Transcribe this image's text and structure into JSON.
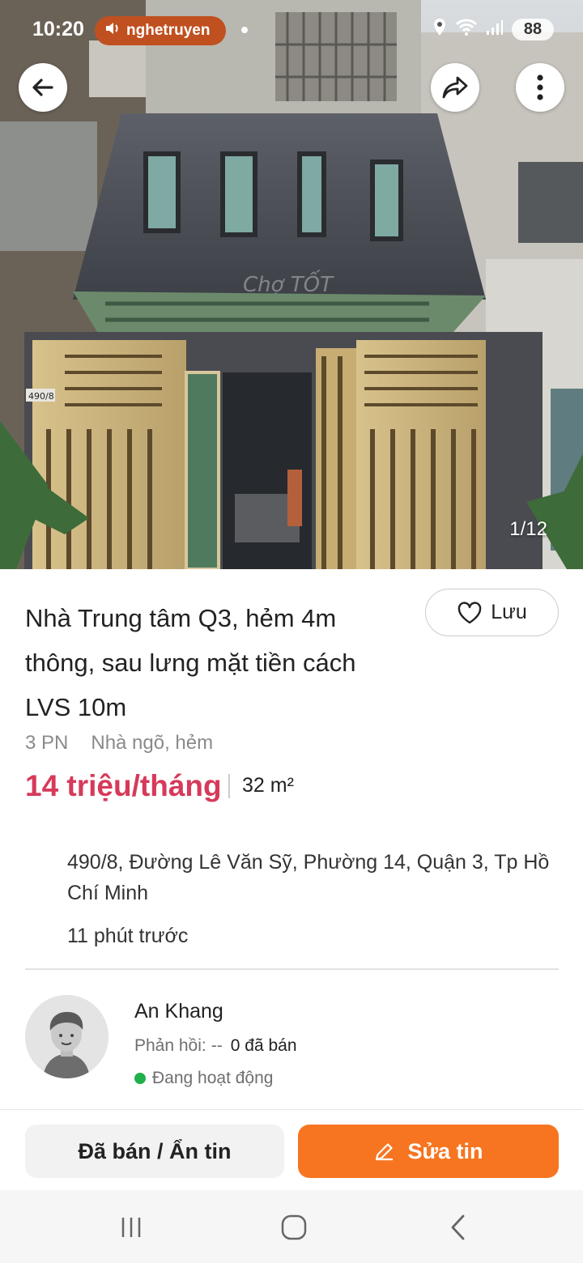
{
  "status_bar": {
    "time": "10:20",
    "media_app": "nghetruyen",
    "battery": "88"
  },
  "hero": {
    "image_counter": "1/12",
    "house_number_plate": "490/8",
    "watermark": "Chợ TỐT",
    "icons": {
      "back": "arrow-left-icon",
      "share": "share-icon",
      "more": "more-vertical-icon"
    }
  },
  "listing": {
    "title_lines": [
      "Nhà Trung tâm Q3, hẻm 4m",
      "thông, sau lưng mặt tiền cách",
      "LVS 10m"
    ],
    "save_label": "Lưu",
    "bedrooms": "3 PN",
    "property_type": "Nhà ngõ, hẻm",
    "price": "14 triệu/tháng",
    "area": "32 m²",
    "address_lines": [
      "490/8, Đường Lê Văn Sỹ, Phường 14, Quận 3, Tp Hồ",
      "Chí Minh"
    ],
    "posted_time": "11 phút trước"
  },
  "seller": {
    "name": "An Khang",
    "response_label": "Phản hồi:",
    "response_value": "--",
    "sold_count": "0 đã bán",
    "status": "Đang hoạt động"
  },
  "actions": {
    "hide_label": "Đã bán / Ẩn tin",
    "edit_label": "Sửa tin"
  },
  "colors": {
    "price": "#d63a5a",
    "edit_button": "#f77520",
    "online_dot": "#20b04b"
  }
}
